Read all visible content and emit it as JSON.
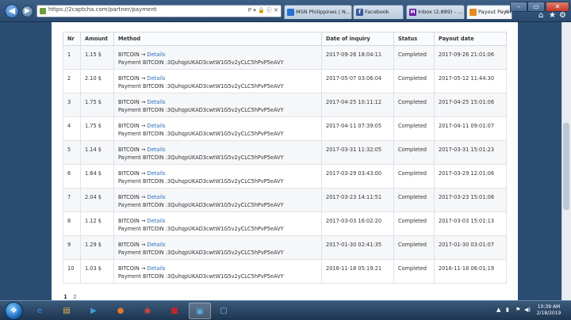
{
  "browser": {
    "back_icon": "back-arrow-icon",
    "address_url": "https://2captcha.com/partner/payment",
    "address_icons": "P ▾ 🔒 ⓒ ✕",
    "tabs": [
      {
        "label": "MSN Philippines | N...",
        "icon": "msn-icon",
        "color": "#2a6fd3"
      },
      {
        "label": "Facebook",
        "icon": "facebook-icon",
        "color": "#3b5998"
      },
      {
        "label": "Inbox (2,889) - ...",
        "icon": "yahoo-mail-icon",
        "color": "#6b1fa6"
      },
      {
        "label": "Payout Payout",
        "icon": "page-icon",
        "color": "#e58a21"
      }
    ],
    "window_controls": {
      "minimize": "–",
      "maximize": "▭",
      "close": "✕"
    }
  },
  "table": {
    "headers": [
      "Nr",
      "Amount",
      "Method",
      "Date of inquiry",
      "Status",
      "Payout date"
    ],
    "rows": [
      {
        "nr": "1",
        "amount": "1.15 $",
        "method": "BITCOIN",
        "link": "Details",
        "payment": "Payment BITCOIN :3QuhqpUKAD3cwtW1G5v2yCLC5hPvP5eAVY",
        "inquiry": "2017-09-26 18:04:11",
        "status": "Completed",
        "payout": "2017-09-26 21:01:06"
      },
      {
        "nr": "2",
        "amount": "2.10 $",
        "method": "BITCOIN",
        "link": "Details",
        "payment": "Payment BITCOIN :3QuhqpUKAD3cwtW1G5v2yCLC5hPvP5eAVY",
        "inquiry": "2017-05-07 03:06:04",
        "status": "Completed",
        "payout": "2017-05-12 11:44:30"
      },
      {
        "nr": "3",
        "amount": "1.75 $",
        "method": "BITCOIN",
        "link": "Details",
        "payment": "Payment BITCOIN :3QuhqpUKAD3cwtW1G5v2yCLC5hPvP5eAVY",
        "inquiry": "2017-04-25 10:11:12",
        "status": "Completed",
        "payout": "2017-04-25 15:01:06"
      },
      {
        "nr": "4",
        "amount": "1.75 $",
        "method": "BITCOIN",
        "link": "Details",
        "payment": "Payment BITCOIN :3QuhqpUKAD3cwtW1G5v2yCLC5hPvP5eAVY",
        "inquiry": "2017-04-11 07:39:05",
        "status": "Completed",
        "payout": "2017-04-11 09:01:07"
      },
      {
        "nr": "5",
        "amount": "1.14 $",
        "method": "BITCOIN",
        "link": "Details",
        "payment": "Payment BITCOIN :3QuhqpUKAD3cwtW1G5v2yCLC5hPvP5eAVY",
        "inquiry": "2017-03-31 11:32:05",
        "status": "Completed",
        "payout": "2017-03-31 15:01:23"
      },
      {
        "nr": "6",
        "amount": "1.64 $",
        "method": "BITCOIN",
        "link": "Details",
        "payment": "Payment BITCOIN :3QuhqpUKAD3cwtW1G5v2yCLC5hPvP5eAVY",
        "inquiry": "2017-03-29 03:43:00",
        "status": "Completed",
        "payout": "2017-03-29 12:01:06"
      },
      {
        "nr": "7",
        "amount": "2.04 $",
        "method": "BITCOIN",
        "link": "Details",
        "payment": "Payment BITCOIN :3QuhqpUKAD3cwtW1G5v2yCLC5hPvP5eAVY",
        "inquiry": "2017-03-23 14:11:51",
        "status": "Completed",
        "payout": "2017-03-23 15:01:06"
      },
      {
        "nr": "8",
        "amount": "1.12 $",
        "method": "BITCOIN",
        "link": "Details",
        "payment": "Payment BITCOIN :3QuhqpUKAD3cwtW1G5v2yCLC5hPvP5eAVY",
        "inquiry": "2017-03-03 16:02:20",
        "status": "Completed",
        "payout": "2017-03-03 15:01:13"
      },
      {
        "nr": "9",
        "amount": "1.29 $",
        "method": "BITCOIN",
        "link": "Details",
        "payment": "Payment BITCOIN :3QuhqpUKAD3cwtW1G5v2yCLC5hPvP5eAVY",
        "inquiry": "2017-01-30 02:41:35",
        "status": "Completed",
        "payout": "2017-01-30 03:01:07"
      },
      {
        "nr": "10",
        "amount": "1.03 $",
        "method": "BITCOIN",
        "link": "Details",
        "payment": "Payment BITCOIN :3QuhqpUKAD3cwtW1G5v2yCLC5hPvP5eAVY",
        "inquiry": "2016-11-18 05:19:21",
        "status": "Completed",
        "payout": "2016-11-18 06:01:19"
      }
    ],
    "method_arrow": "→"
  },
  "pagination": {
    "current": "1",
    "next": "2"
  },
  "taskbar": {
    "apps": [
      {
        "icon": "internet-explorer-icon",
        "glyph": "e",
        "color": "#3a8ee6"
      },
      {
        "icon": "file-explorer-icon",
        "glyph": "▤",
        "color": "#e8b84a"
      },
      {
        "icon": "media-player-icon",
        "glyph": "▶",
        "color": "#3aa0d8"
      },
      {
        "icon": "firefox-icon",
        "glyph": "●",
        "color": "#e2762b"
      },
      {
        "icon": "chrome-icon",
        "glyph": "◉",
        "color": "#d84a3a"
      },
      {
        "icon": "red-app-icon",
        "glyph": "■",
        "color": "#c0262a"
      },
      {
        "icon": "remote-desktop-icon",
        "glyph": "▣",
        "color": "#5cb0e0"
      },
      {
        "icon": "window-icon",
        "glyph": "▢",
        "color": "#8fb4d8"
      }
    ],
    "clock_time": "10:39 AM",
    "clock_date": "2/18/2019"
  }
}
